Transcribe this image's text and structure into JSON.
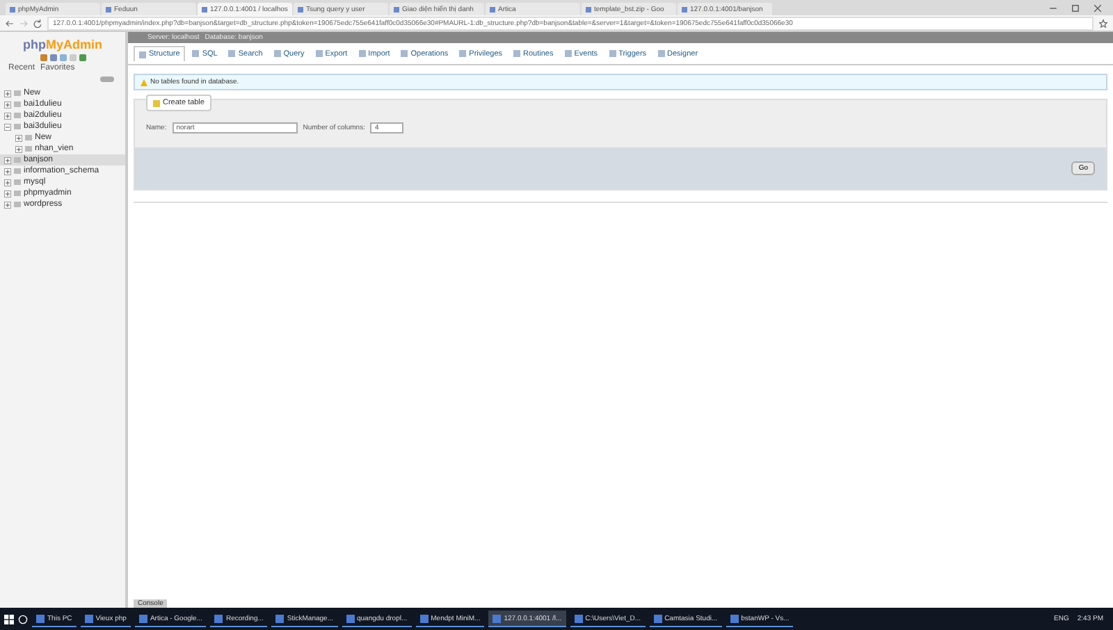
{
  "browser_tabs": [
    {
      "title": "phpMyAdmin",
      "selected": false
    },
    {
      "title": "Feduun",
      "selected": false
    },
    {
      "title": "127.0.0.1:4001 / localhos",
      "selected": true
    },
    {
      "title": "Tsung query y user",
      "selected": false
    },
    {
      "title": "Giao diện hiển thị danh",
      "selected": false
    },
    {
      "title": "Artica",
      "selected": false
    },
    {
      "title": "template_bst.zip - Goo",
      "selected": false
    },
    {
      "title": "127.0.0.1:4001/banjson",
      "selected": false
    }
  ],
  "address": "127.0.0.1:4001/phpmyadmin/index.php?db=banjson&target=db_structure.php&token=190675edc755e641faff0c0d35066e30#PMAURL-1:db_structure.php?db=banjson&table=&server=1&target=&token=190675edc755e641faff0c0d35066e30",
  "sidebar": {
    "logo_php": "php",
    "logo_name": "MyAdmin",
    "links": [
      "Recent",
      "Favorites"
    ],
    "items": [
      {
        "label": "New",
        "selected": false,
        "expanded": false
      },
      {
        "label": "bai1dulieu",
        "selected": false,
        "expanded": false
      },
      {
        "label": "bai2dulieu",
        "selected": false,
        "expanded": false
      },
      {
        "label": "bai3dulieu",
        "selected": false,
        "expanded": true,
        "children": [
          {
            "label": "New",
            "selected": false,
            "expanded": false
          },
          {
            "label": "nhan_vien",
            "selected": false,
            "expanded": false
          }
        ]
      },
      {
        "label": "banjson",
        "selected": true,
        "expanded": false
      },
      {
        "label": "information_schema",
        "selected": false,
        "expanded": false
      },
      {
        "label": "mysql",
        "selected": false,
        "expanded": false
      },
      {
        "label": "phpmyadmin",
        "selected": false,
        "expanded": false
      },
      {
        "label": "wordpress",
        "selected": false,
        "expanded": false
      }
    ]
  },
  "breadcrumb": [
    "Server: localhost",
    "Database: banjson"
  ],
  "tabs": [
    {
      "label": "Structure",
      "selected": true
    },
    {
      "label": "SQL",
      "selected": false
    },
    {
      "label": "Search",
      "selected": false
    },
    {
      "label": "Query",
      "selected": false
    },
    {
      "label": "Export",
      "selected": false
    },
    {
      "label": "Import",
      "selected": false
    },
    {
      "label": "Operations",
      "selected": false
    },
    {
      "label": "Privileges",
      "selected": false
    },
    {
      "label": "Routines",
      "selected": false
    },
    {
      "label": "Events",
      "selected": false
    },
    {
      "label": "Triggers",
      "selected": false
    },
    {
      "label": "Designer",
      "selected": false
    }
  ],
  "notice": "No tables found in database.",
  "create_table": {
    "legend": "Create table",
    "name_label": "Name:",
    "name_value": "norart",
    "columns_label": "Number of columns:",
    "columns_value": "4",
    "go": "Go"
  },
  "console": "Console",
  "taskbar": {
    "apps": [
      {
        "label": "This PC",
        "selected": false
      },
      {
        "label": "Vieux php",
        "selected": false
      },
      {
        "label": "Artica - Google...",
        "selected": false
      },
      {
        "label": "Recording...",
        "selected": false
      },
      {
        "label": "StickManage...",
        "selected": false
      },
      {
        "label": "quangdu dropl...",
        "selected": false
      },
      {
        "label": "Mendpt MiniM...",
        "selected": false
      },
      {
        "label": "127.0.0.1:4001 /l...",
        "selected": true
      },
      {
        "label": "C:\\Users\\Viet_D...",
        "selected": false
      },
      {
        "label": "Camtasia Studi...",
        "selected": false
      },
      {
        "label": "bstanWP - Vs...",
        "selected": false
      }
    ],
    "language": "ENG",
    "time": "2:43 PM"
  }
}
